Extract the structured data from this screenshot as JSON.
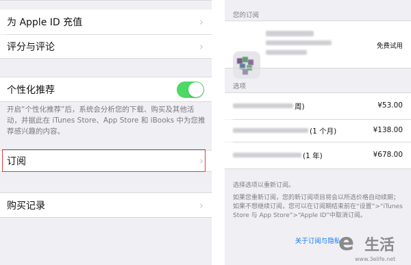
{
  "left": {
    "rows": [
      {
        "label": "为 Apple ID 充值"
      },
      {
        "label": "评分与评论"
      }
    ],
    "personalized": {
      "label": "个性化推荐",
      "on": true,
      "description": "开启“个性化推荐”后，系统会分析您的下载、购买及其他活动，并据此在 iTunes Store、App Store 和 iBooks 中为您推荐感兴趣的内容。"
    },
    "subscriptions_row": {
      "label": "订阅"
    },
    "purchase_history_row": {
      "label": "购买记录"
    }
  },
  "right": {
    "your_subscription_header": "您的订阅",
    "current_status": "免费试用",
    "options_header": "选项",
    "plans": [
      {
        "duration": "周)",
        "price": "¥53.00"
      },
      {
        "duration": "(1 个月)",
        "price": "¥138.00"
      },
      {
        "duration": "(1 年)",
        "price": "¥678.00"
      }
    ],
    "resubscribe_hint": "选择选项以重新订阅。",
    "renewal_note": "如果您重新订阅，您的新订阅项目将会以所选价格自动续期；如果不想继续订阅，您可以在订阅期结束前在“设置”>“iTunes Store 与 App Store”>“Apple ID”中取消订阅。",
    "privacy_link": "关于订阅与隐私"
  },
  "watermark": {
    "glyph": "e",
    "text": "生活",
    "url": "www.3elife.net"
  },
  "colors": {
    "toggle_on": "#4cd964",
    "highlight": "#e23b3b",
    "link": "#1a7cf4"
  }
}
